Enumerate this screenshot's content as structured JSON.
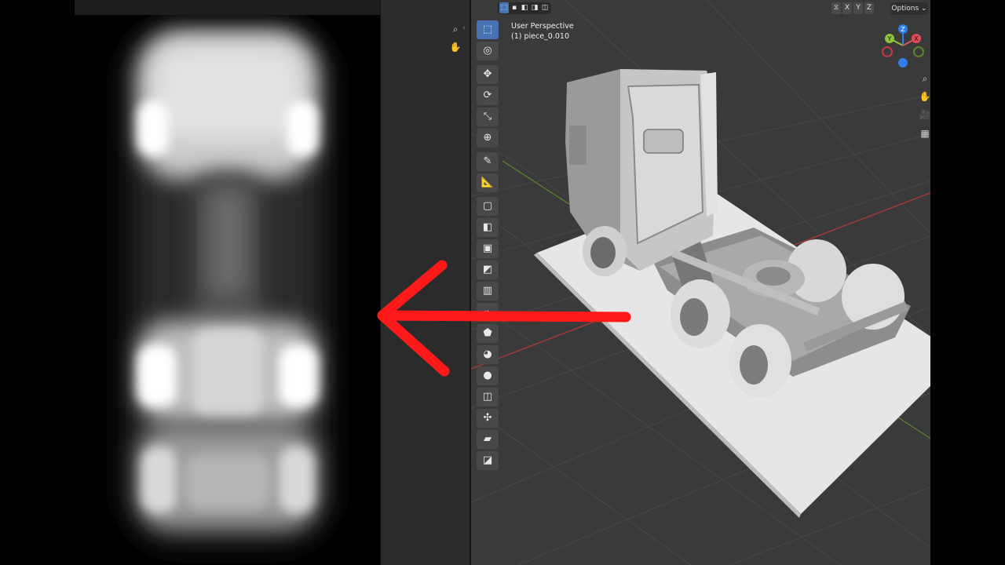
{
  "viewport": {
    "view_name": "User Perspective",
    "object_name": "(1) piece_0.010",
    "options_label": "Options",
    "axis_labels": [
      "X",
      "Y",
      "Z"
    ],
    "header_mode_icons": [
      "select-box-icon",
      "mode-new-icon",
      "mode-extend-icon",
      "mode-subtract-icon",
      "mode-intersect-icon"
    ]
  },
  "toolbar": {
    "tools": [
      {
        "name": "select-box",
        "glyph": "⬚",
        "active": true
      },
      {
        "name": "cursor",
        "glyph": "◎",
        "active": false
      },
      {
        "name": "move",
        "glyph": "✥",
        "active": false
      },
      {
        "name": "rotate",
        "glyph": "⟳",
        "active": false
      },
      {
        "name": "scale",
        "glyph": "⤡",
        "active": false
      },
      {
        "name": "transform",
        "glyph": "⊕",
        "active": false
      },
      {
        "name": "annotate",
        "glyph": "✎",
        "active": false
      },
      {
        "name": "measure",
        "glyph": "📐",
        "active": false
      },
      {
        "name": "add-cube",
        "glyph": "▢",
        "active": false
      },
      {
        "name": "extrude",
        "glyph": "◧",
        "active": false
      },
      {
        "name": "inset",
        "glyph": "▣",
        "active": false
      },
      {
        "name": "bevel",
        "glyph": "◩",
        "active": false
      },
      {
        "name": "loop-cut",
        "glyph": "▥",
        "active": false
      },
      {
        "name": "knife",
        "glyph": "⌁",
        "active": false
      },
      {
        "name": "poly-build",
        "glyph": "⬟",
        "active": false
      },
      {
        "name": "spin",
        "glyph": "◕",
        "active": false
      },
      {
        "name": "smooth",
        "glyph": "●",
        "active": false
      },
      {
        "name": "edge-slide",
        "glyph": "◫",
        "active": false
      },
      {
        "name": "shrink-fatten",
        "glyph": "✣",
        "active": false
      },
      {
        "name": "shear",
        "glyph": "▰",
        "active": false
      },
      {
        "name": "rip",
        "glyph": "◪",
        "active": false
      }
    ]
  },
  "nav": {
    "icons": [
      "zoom-icon",
      "hand-pan-icon",
      "camera-icon",
      "grid-icon"
    ]
  },
  "gizmo": {
    "axes": [
      {
        "label": "Y",
        "color": "#8cc63f"
      },
      {
        "label": "Z",
        "color": "#2f7fe6"
      },
      {
        "label": "X",
        "color": "#e44b56"
      }
    ]
  },
  "colors": {
    "accent": "#4772b3",
    "viewport_bg": "#3a3a3a",
    "grid_line": "#474747",
    "x_axis": "#a83a3a",
    "y_axis": "#5a8a2a",
    "arrow": "#ff1a1a"
  }
}
